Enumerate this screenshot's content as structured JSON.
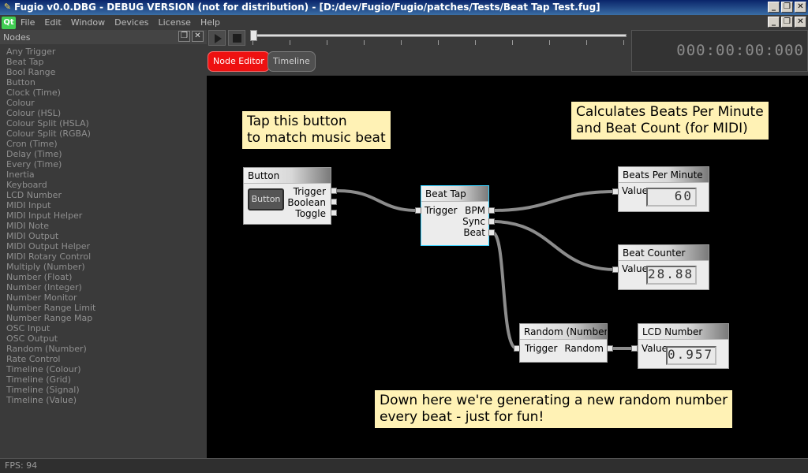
{
  "window": {
    "title": "Fugio v0.0.DBG - DEBUG VERSION (not for distribution) - [D:/dev/Fugio/Fugio/patches/Tests/Beat Tap Test.fug]",
    "min_glyph": "_",
    "max_glyph": "❐",
    "close_glyph": "✕"
  },
  "menubar": {
    "logo": "Qt",
    "items": [
      "File",
      "Edit",
      "Window",
      "Devices",
      "License",
      "Help"
    ]
  },
  "dock": {
    "title": "Nodes",
    "items": [
      "Any Trigger",
      "Beat Tap",
      "Bool Range",
      "Button",
      "Clock (Time)",
      "Colour",
      "Colour (HSL)",
      "Colour Split (HSLA)",
      "Colour Split (RGBA)",
      "Cron (Time)",
      "Delay (Time)",
      "Every (Time)",
      "Inertia",
      "Keyboard",
      "LCD Number",
      "MIDI Input",
      "MIDI Input Helper",
      "MIDI Note",
      "MIDI Output",
      "MIDI Output Helper",
      "MIDI Rotary Control",
      "Multiply (Number)",
      "Number (Float)",
      "Number (Integer)",
      "Number Monitor",
      "Number Range Limit",
      "Number Range Map",
      "OSC Input",
      "OSC Output",
      "Random (Number)",
      "Rate Control",
      "Timeline (Colour)",
      "Timeline (Grid)",
      "Timeline (Signal)",
      "Timeline (Value)"
    ]
  },
  "transport": {
    "node_editor_label": "Node Editor",
    "timeline_label": "Timeline",
    "time": "000:00:00:000"
  },
  "notes": {
    "tap": [
      "Tap this button",
      "to match music beat"
    ],
    "calc": [
      "Calculates Beats Per Minute",
      "and Beat Count (for MIDI)"
    ],
    "random": [
      "Down here we're generating a new random number",
      "every beat - just for fun!"
    ]
  },
  "nodes": {
    "button": {
      "title": "Button",
      "widget_label": "Button",
      "outputs": [
        "Trigger",
        "Boolean",
        "Toggle"
      ]
    },
    "beat_tap": {
      "title": "Beat Tap",
      "input": "Trigger",
      "outputs": [
        "BPM",
        "Sync",
        "Beat"
      ]
    },
    "bpm": {
      "title": "Beats Per Minute",
      "input": "Value",
      "value": "60"
    },
    "beat_counter": {
      "title": "Beat Counter",
      "input": "Value",
      "value": "28.88"
    },
    "random": {
      "title": "Random (Number)",
      "input": "Trigger",
      "output": "Random"
    },
    "lcd": {
      "title": "LCD Number",
      "input": "Value",
      "value": "0.957"
    }
  },
  "status": {
    "fps": "FPS: 94"
  }
}
